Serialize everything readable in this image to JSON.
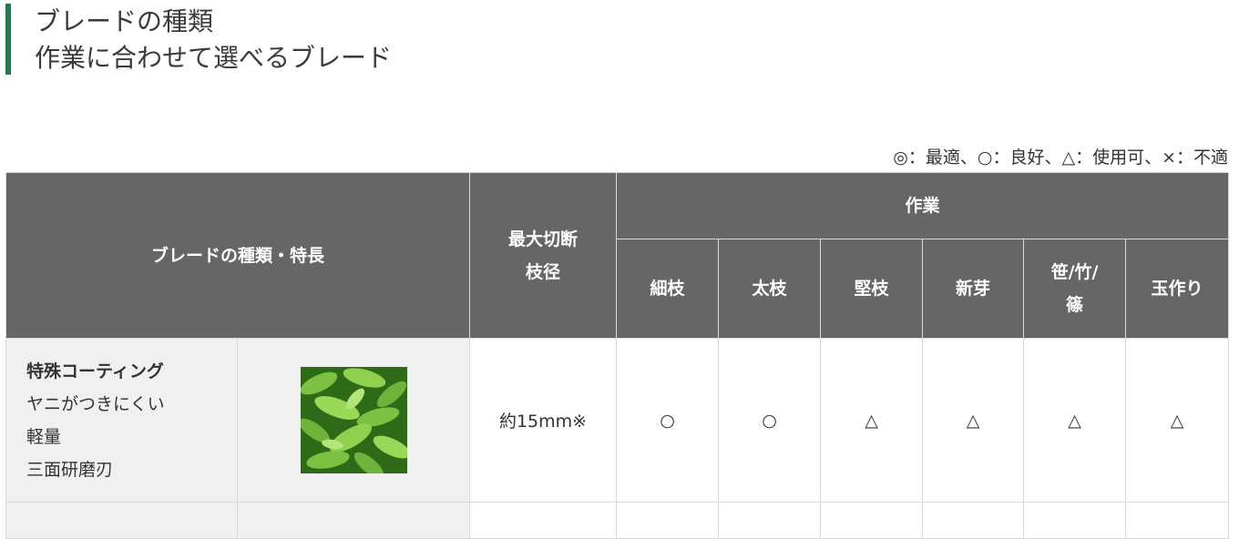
{
  "heading": {
    "line1": "ブレードの種類",
    "line2": "作業に合わせて選べるブレード"
  },
  "legend": "◎：最適、○：良好、△：使用可、×：不適",
  "table": {
    "col_type": "ブレードの種類・特長",
    "col_diameter_1": "最大切断",
    "col_diameter_2": "枝径",
    "col_work": "作業",
    "work_cols": {
      "thin": "細枝",
      "thick": "太枝",
      "hard": "堅枝",
      "shoot": "新芽",
      "bamboo_1": "笹/竹/",
      "bamboo_2": "篠",
      "ball": "玉作り"
    },
    "rows": [
      {
        "name": "特殊コーティング",
        "features": [
          "ヤニがつきにくい",
          "軽量",
          "三面研磨刃"
        ],
        "diameter": "約15mm※",
        "marks": [
          "○",
          "○",
          "△",
          "△",
          "△",
          "△"
        ]
      }
    ]
  }
}
